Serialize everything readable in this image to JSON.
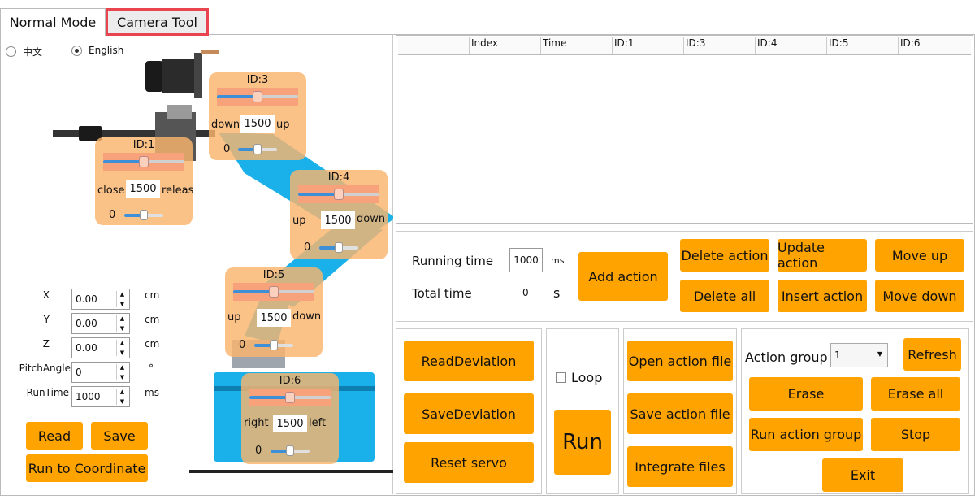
{
  "tabs": [
    {
      "label": "Normal Mode",
      "active": true
    },
    {
      "label": "Camera Tool",
      "active": false
    }
  ],
  "language": {
    "options": [
      "中文",
      "English"
    ],
    "selected": "English"
  },
  "servos": {
    "id1": {
      "title": "ID:1",
      "left_label": "close",
      "right_label": "releas",
      "value": "1500",
      "deviation": "0"
    },
    "id3": {
      "title": "ID:3",
      "left_label": "down",
      "right_label": "up",
      "value": "1500",
      "deviation": "0"
    },
    "id4": {
      "title": "ID:4",
      "left_label": "up",
      "right_label": "down",
      "value": "1500",
      "deviation": "0"
    },
    "id5": {
      "title": "ID:5",
      "left_label": "up",
      "right_label": "down",
      "value": "1500",
      "deviation": "0"
    },
    "id6": {
      "title": "ID:6",
      "left_label": "right",
      "right_label": "left",
      "value": "1500",
      "deviation": "0"
    }
  },
  "coords": [
    {
      "label": "X",
      "value": "0.00",
      "unit": "cm"
    },
    {
      "label": "Y",
      "value": "0.00",
      "unit": "cm"
    },
    {
      "label": "Z",
      "value": "0.00",
      "unit": "cm"
    },
    {
      "label": "PitchAngle",
      "value": "0",
      "unit": "°"
    },
    {
      "label": "RunTime",
      "value": "1000",
      "unit": "ms"
    }
  ],
  "coord_buttons": {
    "read": "Read",
    "save": "Save",
    "run_to_coordinate": "Run to Coordinate"
  },
  "action_table": {
    "columns": [
      "",
      "Index",
      "Time",
      "ID:1",
      "ID:3",
      "ID:4",
      "ID:5",
      "ID:6"
    ]
  },
  "timing": {
    "running_time_label": "Running time",
    "running_time_value": "1000",
    "running_time_unit": "ms",
    "total_time_label": "Total time",
    "total_time_value": "0",
    "total_time_unit": "s"
  },
  "action_buttons": {
    "add_action": "Add action",
    "delete_action": "Delete action",
    "update_action": "Update action",
    "move_up": "Move up",
    "delete_all": "Delete all",
    "insert_action": "Insert action",
    "move_down": "Move down"
  },
  "deviation_buttons": {
    "read": "ReadDeviation",
    "save": "SaveDeviation",
    "reset": "Reset servo"
  },
  "run_group": {
    "loop_label": "Loop",
    "run_label": "Run"
  },
  "file_buttons": {
    "open": "Open action file",
    "save": "Save action file",
    "integrate": "Integrate files"
  },
  "action_group": {
    "label": "Action group",
    "selected": "1",
    "refresh": "Refresh",
    "erase": "Erase",
    "erase_all": "Erase all",
    "run_group": "Run action group",
    "stop": "Stop",
    "exit": "Exit"
  },
  "colors": {
    "button": "#ffa300",
    "servo_panel": "#fab46e",
    "slider_fill": "#3d8fd8",
    "arm_blue": "#1ab0ea",
    "highlight": "#e84550"
  }
}
